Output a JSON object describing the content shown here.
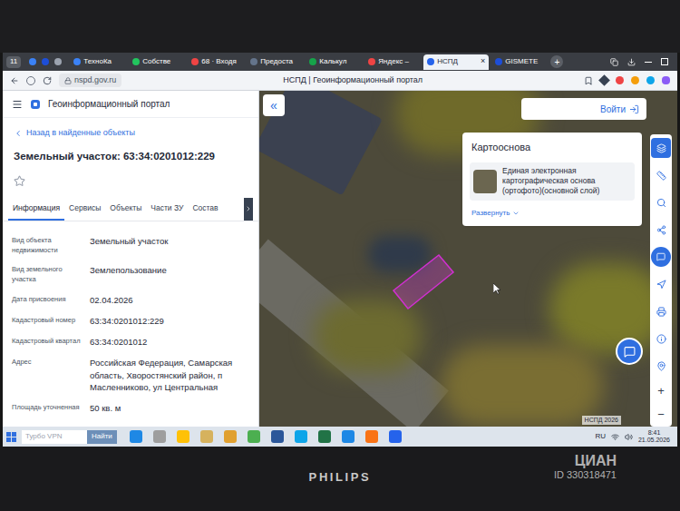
{
  "monitor": {
    "brand": "PHILIPS"
  },
  "watermark": {
    "brand": "ЦИАН",
    "id": "ID 330318471"
  },
  "browser": {
    "tab_count": "11",
    "tabs": [
      {
        "label": "ТехноКа",
        "selected": false
      },
      {
        "label": "Собстве",
        "selected": false
      },
      {
        "label": "68 · Входя",
        "selected": false
      },
      {
        "label": "Предоста",
        "selected": false
      },
      {
        "label": "Калькул",
        "selected": false
      },
      {
        "label": "Яндекс –",
        "selected": false
      },
      {
        "label": "НСПД",
        "selected": true
      },
      {
        "label": "GISMETE",
        "selected": false
      }
    ],
    "close": "×",
    "new_tab": "+",
    "address": "nspd.gov.ru",
    "page_title": "НСПД | Геоинформационный портал"
  },
  "portal": {
    "title": "Геоинформационный портал",
    "collapse": "«"
  },
  "panel": {
    "back": "Назад в найденные объекты",
    "heading": "Земельный участок: 63:34:0201012:229",
    "tabs": [
      {
        "label": "Информация",
        "selected": true
      },
      {
        "label": "Сервисы",
        "selected": false
      },
      {
        "label": "Объекты",
        "selected": false
      },
      {
        "label": "Части ЗУ",
        "selected": false
      },
      {
        "label": "Состав",
        "selected": false
      }
    ],
    "fields": [
      {
        "label": "Вид объекта недвижимости",
        "value": "Земельный участок"
      },
      {
        "label": "Вид земельного участка",
        "value": "Землепользование"
      },
      {
        "label": "Дата присвоения",
        "value": "02.04.2026"
      },
      {
        "label": "Кадастровый номер",
        "value": "63:34:0201012:229"
      },
      {
        "label": "Кадастровый квартал",
        "value": "63:34:0201012"
      },
      {
        "label": "Адрес",
        "value": "Российская Федерация, Самарская область, Хворостянский район, п Масленниково, ул Центральная"
      },
      {
        "label": "Площадь уточненная",
        "value": "50 кв. м"
      }
    ]
  },
  "map": {
    "login": "Войти",
    "basemap": {
      "title": "Картооснова",
      "layer": "Единая электронная картографическая основа (ортофото)(основной слой)",
      "expand": "Развернуть"
    },
    "attribution": "НСПД 2026",
    "zoom_in": "+",
    "zoom_out": "−"
  },
  "taskbar": {
    "search": "Турбо VPN",
    "search_button": "Найти",
    "lang": "RU",
    "time": "8:41",
    "date": "21.05.2026"
  }
}
